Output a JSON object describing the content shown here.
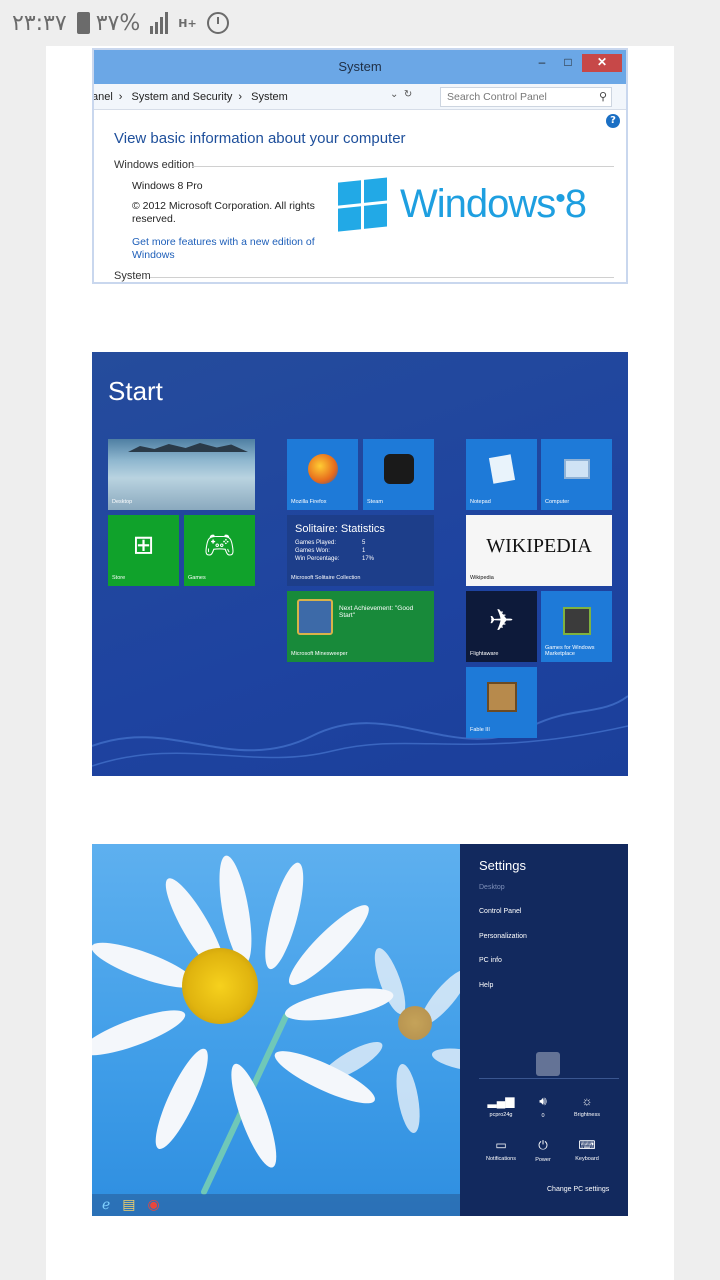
{
  "status_bar": {
    "time": "۲۳:۳۷",
    "battery": "۳۷%",
    "network": "H+"
  },
  "shot1": {
    "window_title": "System",
    "min_icon": "–",
    "max_icon": "□",
    "close_icon": "✕",
    "breadcrumb": [
      "anel",
      "System and Security",
      "System"
    ],
    "search_placeholder": "Search Control Panel",
    "heading": "View basic information about your computer",
    "windows_edition_label": "Windows edition",
    "edition": "Windows 8 Pro",
    "copyright": "© 2012 Microsoft Corporation. All rights reserved.",
    "more_features_link": "Get more features with a new edition of Windows",
    "logo_text": "Windows",
    "logo_version": "8",
    "system_label": "System"
  },
  "shot2": {
    "title": "Start",
    "tiles": {
      "desktop": "Desktop",
      "store": "Store",
      "games": "Games",
      "firefox": "Mozilla Firefox",
      "steam": "Steam",
      "notepad": "Notepad",
      "computer": "Computer",
      "solitaire_title": "Solitaire: Statistics",
      "solitaire_rows": [
        {
          "k": "Games Played:",
          "v": "5"
        },
        {
          "k": "Games Won:",
          "v": "1"
        },
        {
          "k": "Win Percentage:",
          "v": "17%"
        }
      ],
      "solitaire_label": "Microsoft Solitaire Collection",
      "wikipedia_logo": "WIKIPEDIA",
      "wikipedia_label": "Wikipedia",
      "minesweeper_text": "Next Achievement: \"Good Start\"",
      "minesweeper_label": "Microsoft Minesweeper",
      "flightaware": "Flightaware",
      "gfw_label": "Games for Windows Marketplace",
      "fable": "Fable III"
    }
  },
  "shot3": {
    "settings_title": "Settings",
    "items": [
      "Desktop",
      "Control Panel",
      "Personalization",
      "PC info",
      "Help"
    ],
    "quick": {
      "network": "pcpro24g",
      "volume": "0",
      "brightness": "Brightness",
      "notifications": "Notifications",
      "power": "Power",
      "keyboard": "Keyboard"
    },
    "change_pc_settings": "Change PC settings"
  },
  "colors": {
    "card": "#ffffff",
    "page_bg": "#eeeeee",
    "start_bg": "#1e43a0",
    "settings_bg": "#12295e",
    "tile_green": "#10a22b",
    "tile_blue": "#1e7ad8"
  }
}
